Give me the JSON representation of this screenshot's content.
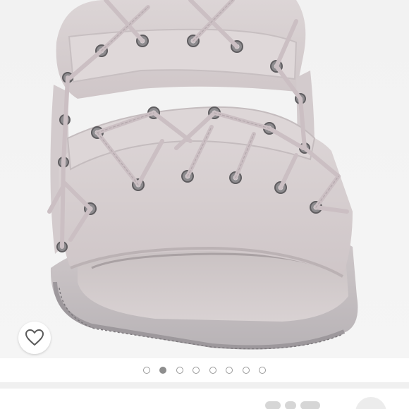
{
  "product_image": {
    "icon": "lace-up-sandal",
    "current_photo": 2,
    "total_photos": 8
  },
  "like_button": {
    "icon": "heart-icon"
  },
  "carousel": {
    "dots": [
      {
        "active": false
      },
      {
        "active": true
      },
      {
        "active": false
      },
      {
        "active": false
      },
      {
        "active": false
      },
      {
        "active": false
      },
      {
        "active": false
      },
      {
        "active": false
      }
    ]
  },
  "colors": {
    "photo_background": "#f3f3f3",
    "sandal_leather": "#d7cfd0",
    "dot_active": "#8e8e8e",
    "dot_inactive_border": "#9a9a9a"
  }
}
